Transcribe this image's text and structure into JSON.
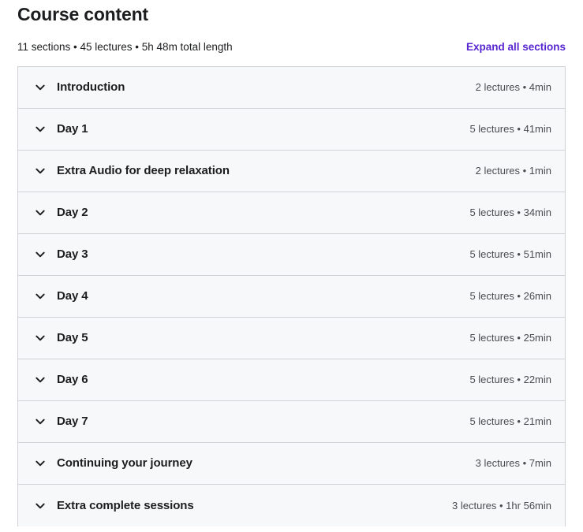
{
  "header": {
    "title": "Course content",
    "summary": "11 sections • 45 lectures • 5h 48m total length",
    "expand_all_label": "Expand all sections",
    "accent_color": "#5624d0"
  },
  "accordion": {
    "chevron_icon": "chevron-down-icon",
    "row_background": "#f7f8fa",
    "border_color": "#d1d2d6",
    "sections": [
      {
        "title": "Introduction",
        "meta": "2 lectures • 4min"
      },
      {
        "title": "Day 1",
        "meta": "5 lectures • 41min"
      },
      {
        "title": "Extra Audio for deep relaxation",
        "meta": "2 lectures • 1min"
      },
      {
        "title": "Day 2",
        "meta": "5 lectures • 34min"
      },
      {
        "title": "Day 3",
        "meta": "5 lectures • 51min"
      },
      {
        "title": "Day 4",
        "meta": "5 lectures • 26min"
      },
      {
        "title": "Day 5",
        "meta": "5 lectures • 25min"
      },
      {
        "title": "Day 6",
        "meta": "5 lectures • 22min"
      },
      {
        "title": "Day 7",
        "meta": "5 lectures • 21min"
      },
      {
        "title": "Continuing your journey",
        "meta": "3 lectures • 7min"
      },
      {
        "title": "Extra complete sessions",
        "meta": "3 lectures • 1hr 56min"
      }
    ]
  }
}
